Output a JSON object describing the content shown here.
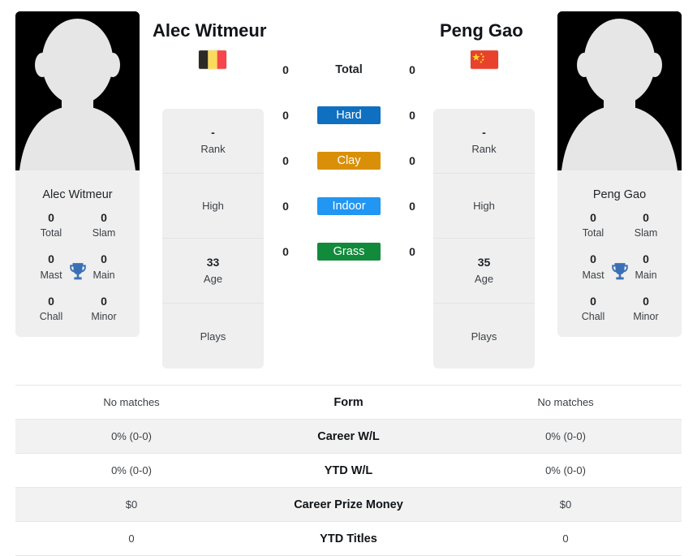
{
  "players": {
    "left": {
      "name": "Alec Witmeur",
      "card_name": "Alec Witmeur",
      "flag": "belgium-flag",
      "titles": {
        "total_value": "0",
        "total_label": "Total",
        "slam_value": "0",
        "slam_label": "Slam",
        "mast_value": "0",
        "mast_label": "Mast",
        "main_value": "0",
        "main_label": "Main",
        "chall_value": "0",
        "chall_label": "Chall",
        "minor_value": "0",
        "minor_label": "Minor"
      },
      "stats": [
        {
          "value": "-",
          "label": "Rank"
        },
        {
          "value": "",
          "label": "High"
        },
        {
          "value": "33",
          "label": "Age"
        },
        {
          "value": "",
          "label": "Plays"
        }
      ]
    },
    "right": {
      "name": "Peng Gao",
      "card_name": "Peng Gao",
      "flag": "china-flag",
      "titles": {
        "total_value": "0",
        "total_label": "Total",
        "slam_value": "0",
        "slam_label": "Slam",
        "mast_value": "0",
        "mast_label": "Mast",
        "main_value": "0",
        "main_label": "Main",
        "chall_value": "0",
        "chall_label": "Chall",
        "minor_value": "0",
        "minor_label": "Minor"
      },
      "stats": [
        {
          "value": "-",
          "label": "Rank"
        },
        {
          "value": "",
          "label": "High"
        },
        {
          "value": "35",
          "label": "Age"
        },
        {
          "value": "",
          "label": "Plays"
        }
      ]
    }
  },
  "surfaces": [
    {
      "label": "Total",
      "left": "0",
      "right": "0",
      "style": "plain",
      "color": ""
    },
    {
      "label": "Hard",
      "left": "0",
      "right": "0",
      "style": "tinted",
      "color": "#0f6fc0"
    },
    {
      "label": "Clay",
      "left": "0",
      "right": "0",
      "style": "tinted",
      "color": "#d99008"
    },
    {
      "label": "Indoor",
      "left": "0",
      "right": "0",
      "style": "tinted",
      "color": "#2196f3"
    },
    {
      "label": "Grass",
      "left": "0",
      "right": "0",
      "style": "tinted",
      "color": "#128a3c"
    }
  ],
  "comparison_rows": [
    {
      "label": "Form",
      "left": "No matches",
      "right": "No matches",
      "alt": false
    },
    {
      "label": "Career W/L",
      "left": "0% (0-0)",
      "right": "0% (0-0)",
      "alt": true
    },
    {
      "label": "YTD W/L",
      "left": "0% (0-0)",
      "right": "0% (0-0)",
      "alt": false
    },
    {
      "label": "Career Prize Money",
      "left": "$0",
      "right": "$0",
      "alt": true
    },
    {
      "label": "YTD Titles",
      "left": "0",
      "right": "0",
      "alt": false
    }
  ],
  "colors": {
    "hard": "#0f6fc0",
    "clay": "#d99008",
    "indoor": "#2196f3",
    "grass": "#128a3c",
    "trophy": "#3b6fb5",
    "panel_bg": "#efefef",
    "row_alt_bg": "#f2f2f2"
  }
}
